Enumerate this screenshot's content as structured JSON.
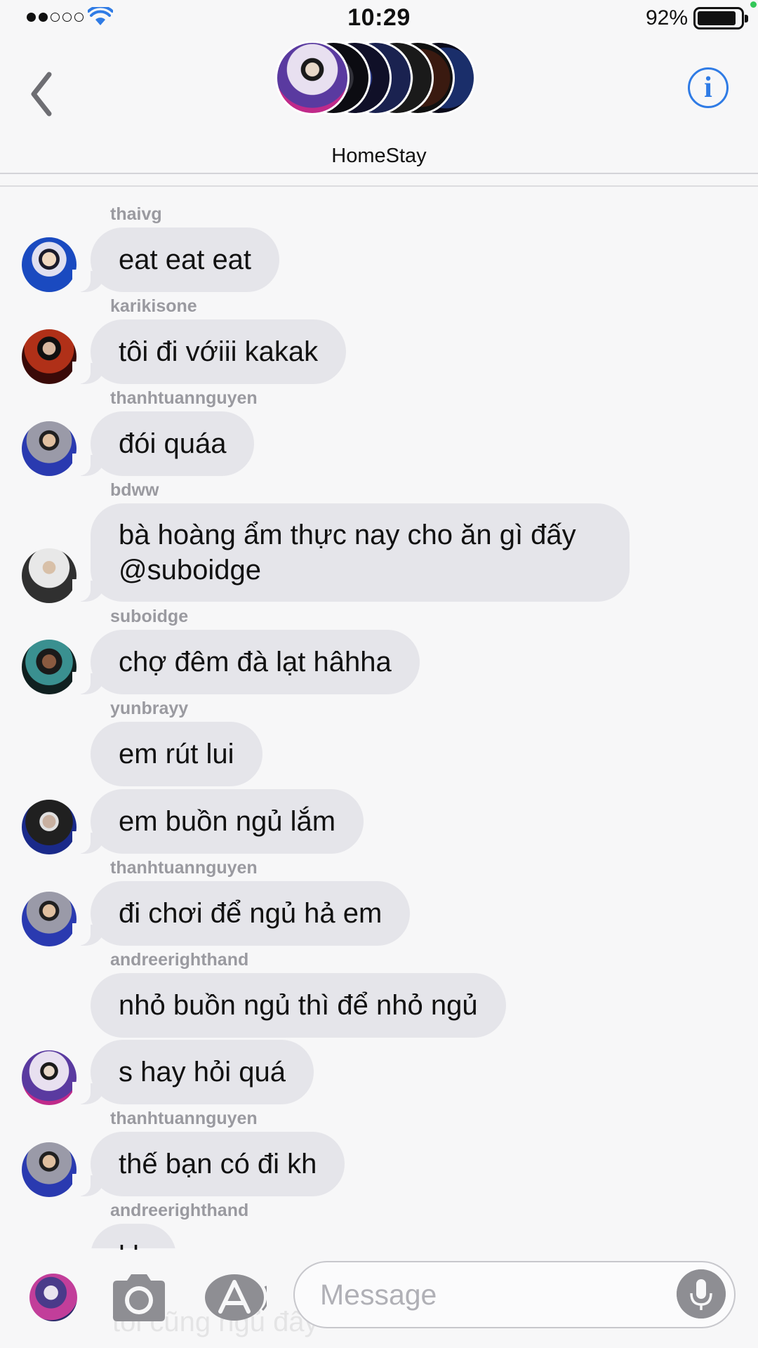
{
  "status_bar": {
    "time": "10:29",
    "battery": "92%"
  },
  "header": {
    "group_name": "HomeStay"
  },
  "messages": [
    {
      "sender": "thaivg",
      "text": "eat eat eat"
    },
    {
      "sender": "karikisone",
      "text": "tôi đi vớiii kakak"
    },
    {
      "sender": "thanhtuannguyen",
      "text": "đói quáa"
    },
    {
      "sender": "bdww",
      "line1": "bà hoàng ẩm thực nay cho ăn gì đấy",
      "line2": "@suboidge"
    },
    {
      "sender": "suboidge",
      "text": "chợ đêm đà lạt hâhha"
    },
    {
      "sender": "yunbrayy",
      "text": "em rút lui"
    },
    {
      "text": "em buồn ngủ lắm"
    },
    {
      "sender": "thanhtuannguyen",
      "text": "đi chơi để ngủ hả em"
    },
    {
      "sender": "andreerighthand",
      "text": "nhỏ buồn ngủ thì để nhỏ ngủ"
    },
    {
      "text": "s hay hỏi quá"
    },
    {
      "sender": "thanhtuannguyen",
      "text": "thế bạn có đi kh"
    },
    {
      "sender": "andreerighthand",
      "text": "kh"
    }
  ],
  "input": {
    "placeholder": "Message",
    "ghost_text": "tôi cũng ngủ đây"
  },
  "colors": {
    "accent": "#2f7be5",
    "bubble": "#e5e5ea",
    "sender": "#9a9aa0"
  },
  "icons": [
    "back-chevron-icon",
    "info-icon",
    "camera-icon",
    "app-store-icon",
    "microphone-icon",
    "wifi-icon",
    "battery-icon"
  ]
}
